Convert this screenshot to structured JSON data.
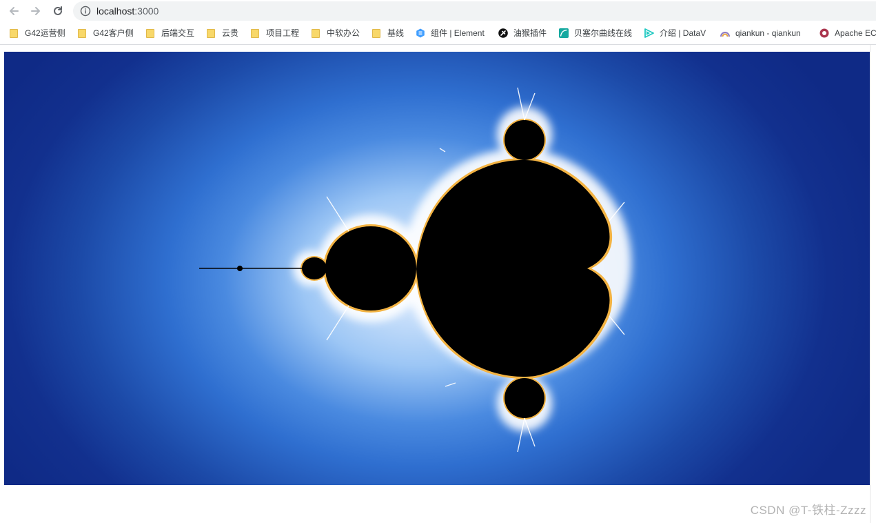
{
  "browser": {
    "url_host": "localhost",
    "url_port": ":3000"
  },
  "bookmarks": [
    {
      "label": "G42运营侧",
      "icon": "folder-icon"
    },
    {
      "label": "G42客户侧",
      "icon": "folder-icon"
    },
    {
      "label": "后端交互",
      "icon": "folder-icon"
    },
    {
      "label": "云贵",
      "icon": "folder-icon"
    },
    {
      "label": "项目工程",
      "icon": "folder-icon"
    },
    {
      "label": "中软办公",
      "icon": "folder-icon"
    },
    {
      "label": "基线",
      "icon": "folder-icon"
    },
    {
      "label": "组件 | Element",
      "icon": "element-logo-icon"
    },
    {
      "label": "油猴插件",
      "icon": "tampermonkey-icon"
    },
    {
      "label": "贝塞尔曲线在线",
      "icon": "bezier-icon"
    },
    {
      "label": "介绍 | DataV",
      "icon": "datav-icon"
    },
    {
      "label": "qiankun - qiankun",
      "icon": "qiankun-icon"
    },
    {
      "label": "Apache EC",
      "icon": "echarts-icon"
    }
  ],
  "watermark": "CSDN @T-铁柱-Zzzz",
  "colors": {
    "canvas_dark": "#0f2a86",
    "canvas_mid": "#2f6fd0",
    "canvas_glow": "#e9f2ff",
    "set_fill": "#000000",
    "edge_gold": "#f3b343"
  }
}
